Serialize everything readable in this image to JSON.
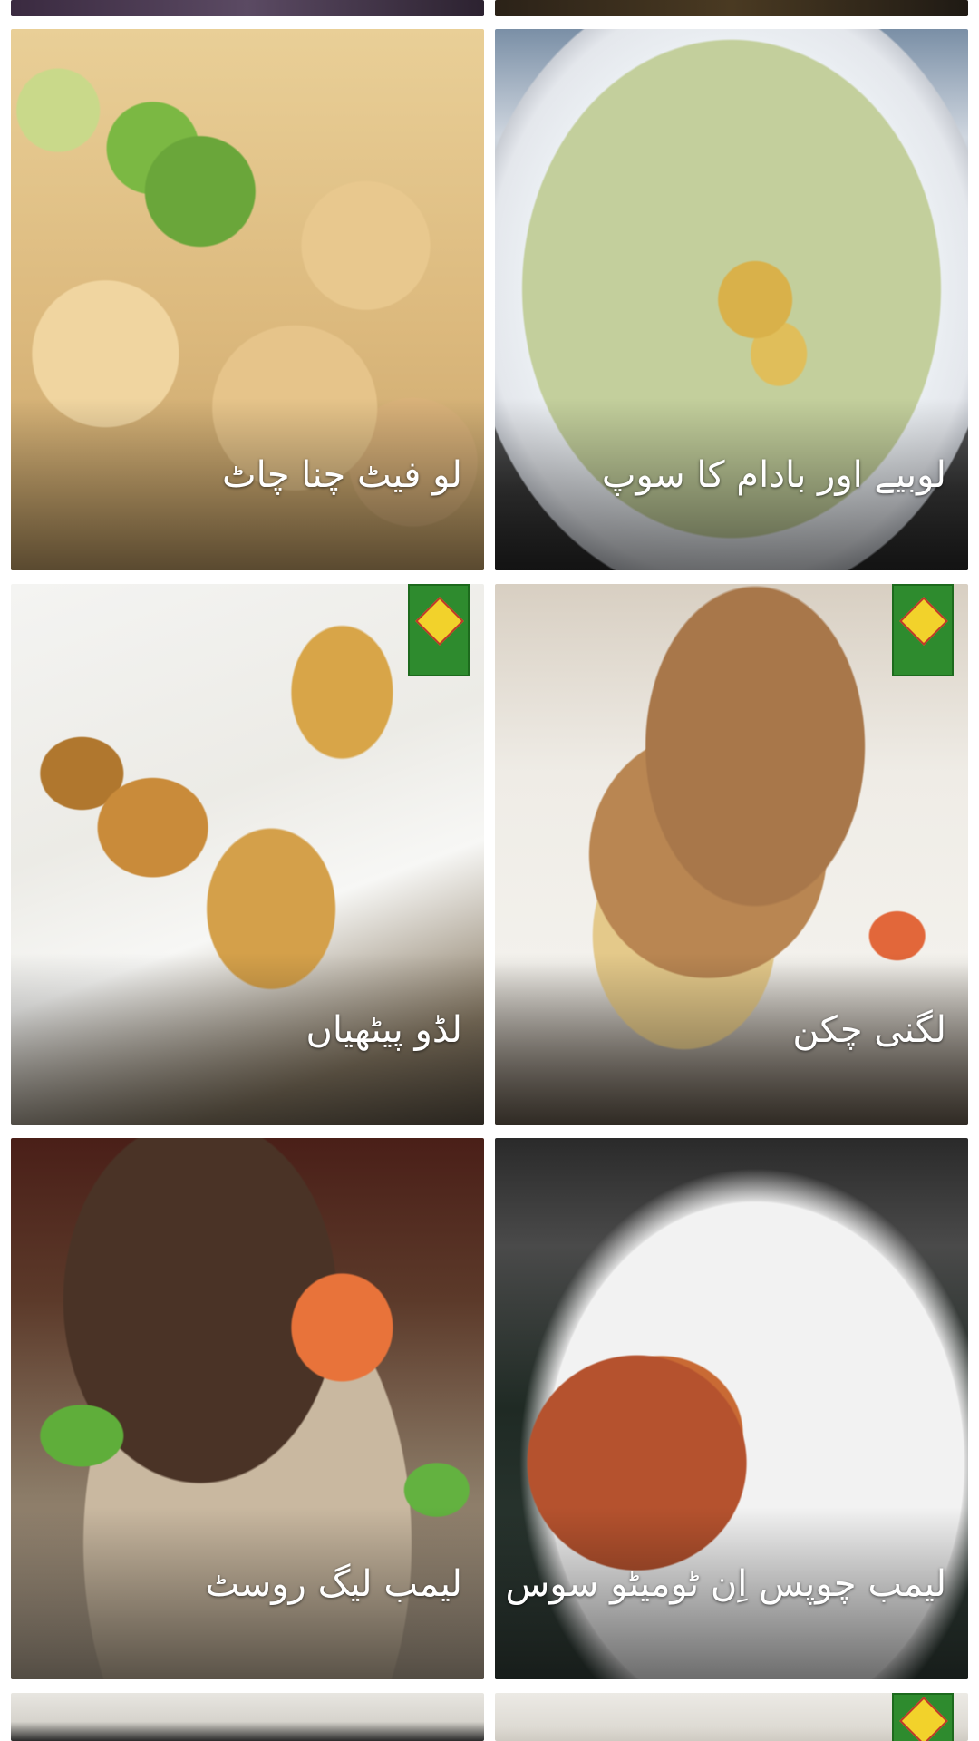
{
  "recipes": [
    {
      "title": "لو فیٹ چنا چاٹ"
    },
    {
      "title": "لوبیے اور بادام کا سوپ"
    },
    {
      "title": "لڈو پیٹھیاں"
    },
    {
      "title": "لگنی چکن"
    },
    {
      "title": "لیمب لیگ روسٹ"
    },
    {
      "title": "لیمب چوپس اِن ٹومیٹو سوس"
    }
  ],
  "icons": {
    "watermark": "hum-masala-logo-icon"
  }
}
